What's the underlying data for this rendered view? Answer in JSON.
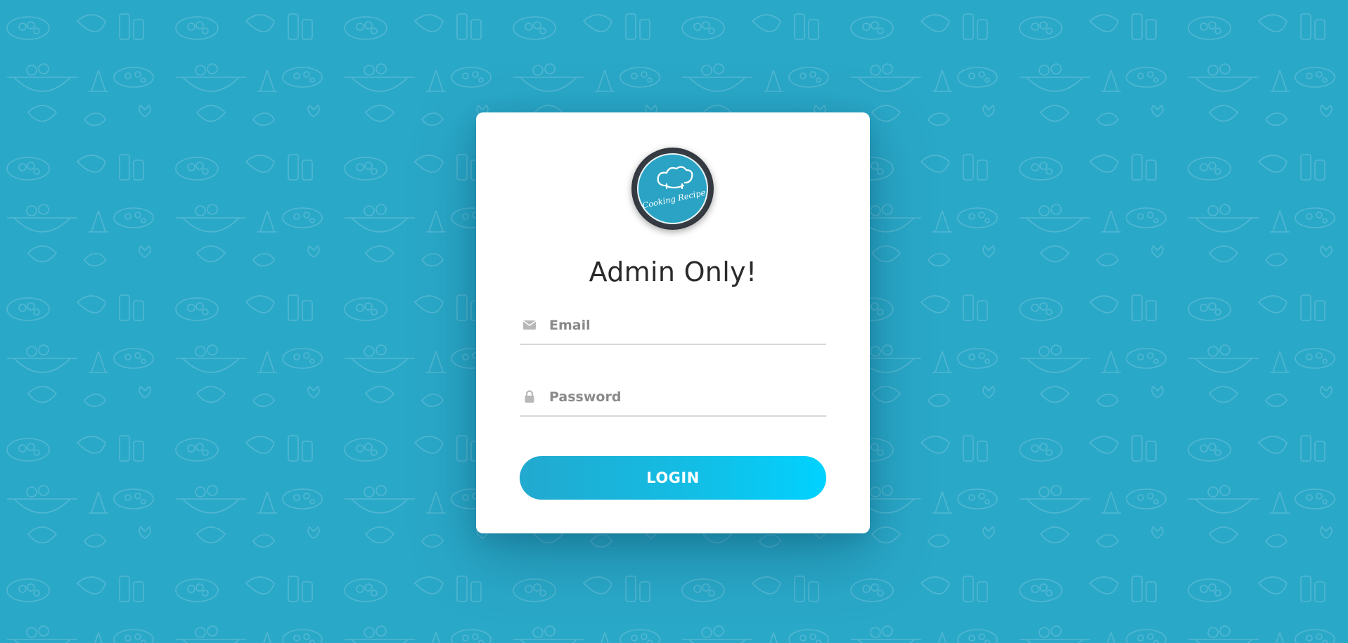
{
  "colors": {
    "background": "#2aa8c8",
    "card": "#ffffff",
    "button_start": "#22a9cf",
    "button_end": "#00d2ff",
    "title_text": "#2a2a2a",
    "field_icon": "#b8b8b8"
  },
  "logo": {
    "text": "Cooking Recipe",
    "icon": "chef-hat-icon"
  },
  "login_card": {
    "title": "Admin Only!",
    "email_field": {
      "placeholder": "Email",
      "value": "",
      "icon": "envelope-icon"
    },
    "password_field": {
      "placeholder": "Password",
      "value": "",
      "icon": "lock-icon"
    },
    "login_button_label": "LOGIN"
  }
}
